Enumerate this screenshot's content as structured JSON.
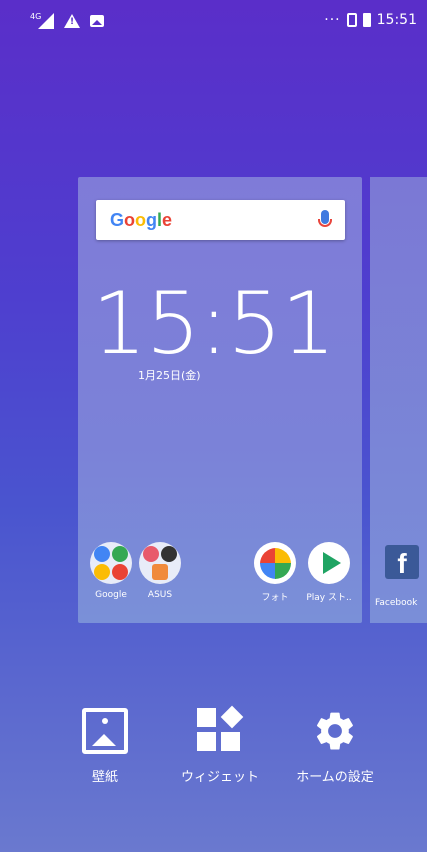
{
  "status_bar": {
    "network": "4G",
    "time": "15:51",
    "more_indicator": "···",
    "icons": [
      "signal-4g-icon",
      "warning-icon",
      "image-icon",
      "vibrate-icon",
      "battery-icon"
    ]
  },
  "home_preview": {
    "search": {
      "logo": "Google"
    },
    "clock": "15:51",
    "date": "1月25日(金)",
    "apps": [
      {
        "label": "Google",
        "icon": "google-folder-icon"
      },
      {
        "label": "ASUS",
        "icon": "asus-folder-icon"
      },
      {
        "label": "フォト",
        "icon": "photos-icon"
      },
      {
        "label": "Play スト..",
        "icon": "play-store-icon"
      }
    ]
  },
  "side_preview": {
    "apps": [
      {
        "label": "Facebook",
        "icon": "facebook-icon"
      }
    ]
  },
  "bottom_menu": [
    {
      "label": "壁紙",
      "icon": "wallpaper-icon"
    },
    {
      "label": "ウィジェット",
      "icon": "widgets-icon"
    },
    {
      "label": "ホームの設定",
      "icon": "gear-icon"
    }
  ],
  "colors": {
    "google_blue": "#4285f4",
    "google_red": "#ea4335",
    "google_yellow": "#fbbc05",
    "google_green": "#34a853",
    "facebook": "#3b5998"
  }
}
